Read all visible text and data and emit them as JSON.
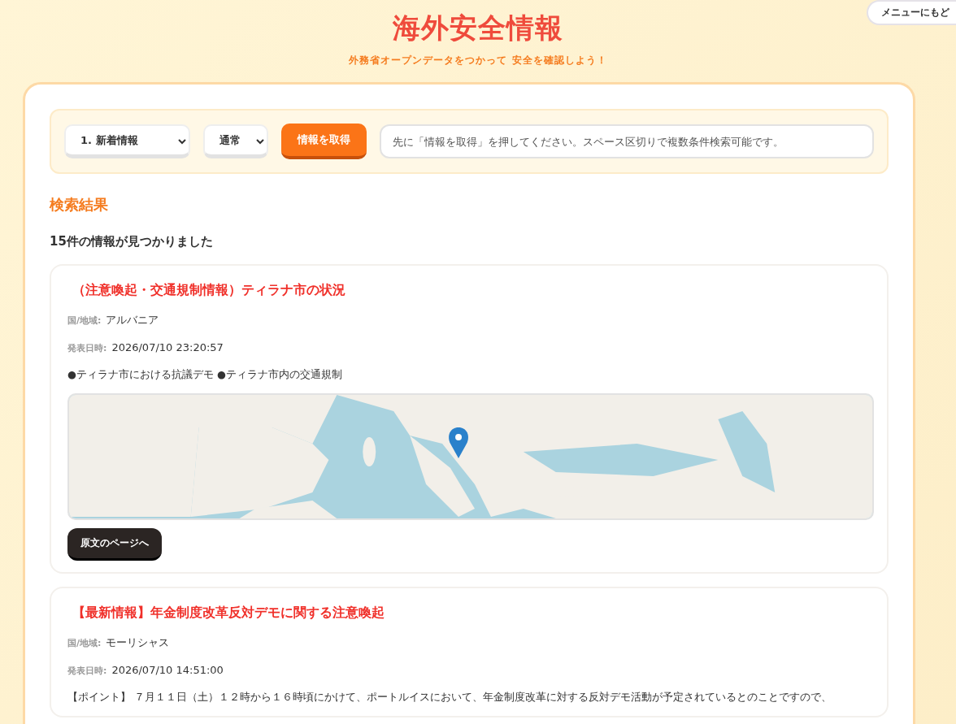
{
  "header": {
    "title": "海外安全情報",
    "subtitle": "外務省オープンデータをつかって 安全を確認しよう！",
    "menu_button": "メニューにもど"
  },
  "controls": {
    "category": "1. 新着情報",
    "mode": "通常",
    "fetch_button": "情報を取得",
    "search": {
      "placeholder": "先に「情報を取得」を押してください。スペース区切りで複数条件検索可能です。"
    }
  },
  "results": {
    "heading": "検索結果",
    "count": "15件の情報が見つかりました",
    "items": [
      {
        "title": "（注意喚起・交通規制情報）ティラナ市の状況",
        "country_label": "国/地域:",
        "country": "アルバニア",
        "date_label": "発表日時:",
        "date": "2026/07/10 23:20:57",
        "summary": "●ティラナ市における抗議デモ ●ティラナ市内の交通規制",
        "link_button": "原文のページへ"
      },
      {
        "title": "【最新情報】年金制度改革反対デモに関する注意喚起",
        "country_label": "国/地域:",
        "country": "モーリシャス",
        "date_label": "発表日時:",
        "date": "2026/07/10 14:51:00",
        "summary": "【ポイント】 ７月１１日（土）１２時から１６時頃にかけて、ポートルイスにおいて、年金制度改革に対する反対デモ活動が予定されているとのことですので、"
      }
    ]
  }
}
